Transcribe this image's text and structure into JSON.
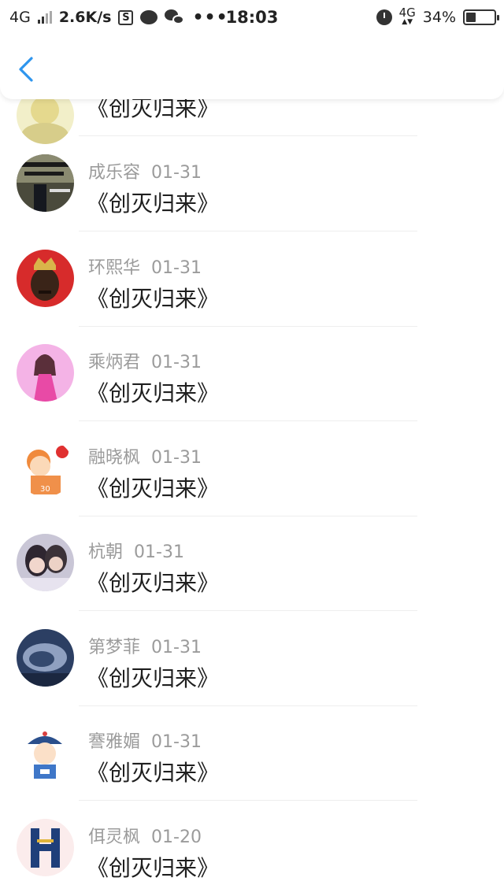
{
  "status_bar": {
    "network": "4G",
    "speed": "2.6K/s",
    "box_icon": "S",
    "dots": "•••",
    "time": "18:03",
    "net_type": "4G",
    "battery_percent": "34%",
    "battery_level": 0.34
  },
  "header": {
    "back_icon": "chevron-left-icon",
    "accent": "#2e95ee"
  },
  "comments": [
    {
      "name": "",
      "date": "",
      "text": "《创灭归来》",
      "avatar": "yellow-avatar"
    },
    {
      "name": "成乐容",
      "date": "01-31",
      "text": "《创灭归来》",
      "avatar": "dark-poster-avatar"
    },
    {
      "name": "环熙华",
      "date": "01-31",
      "text": "《创灭归来》",
      "avatar": "crown-face-avatar"
    },
    {
      "name": "乘炳君",
      "date": "01-31",
      "text": "《创灭归来》",
      "avatar": "pink-girl-avatar"
    },
    {
      "name": "融晓枫",
      "date": "01-31",
      "text": "《创灭归来》",
      "avatar": "cartoon-boy-avatar"
    },
    {
      "name": "杭朝",
      "date": "01-31",
      "text": "《创灭归来》",
      "avatar": "couple-photo-avatar"
    },
    {
      "name": "第梦菲",
      "date": "01-31",
      "text": "《创灭归来》",
      "avatar": "blue-landscape-avatar"
    },
    {
      "name": "謇雅媚",
      "date": "01-31",
      "text": "《创灭归来》",
      "avatar": "qing-official-avatar"
    },
    {
      "name": "佴灵枫",
      "date": "01-20",
      "text": "《创灭归来》",
      "avatar": "letter-h-avatar"
    }
  ]
}
